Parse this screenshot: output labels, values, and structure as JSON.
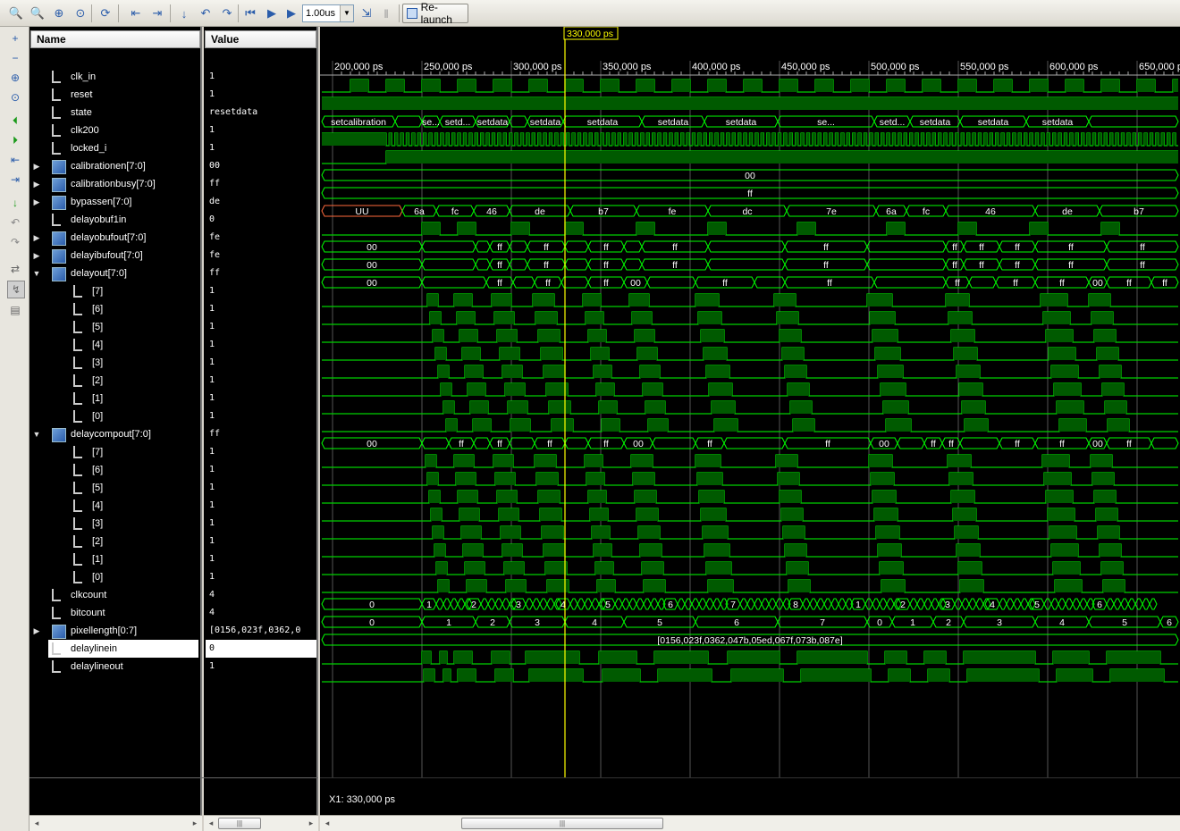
{
  "toolbar": {
    "time_value": "1.00us",
    "relaunch_label": "Re-launch"
  },
  "columns": {
    "name": "Name",
    "value": "Value"
  },
  "cursor": {
    "label": "330,000 ps",
    "readout": "X1: 330,000 ps"
  },
  "time_axis": {
    "ticks": [
      "200,000 ps",
      "250,000 ps",
      "300,000 ps",
      "350,000 ps",
      "400,000 ps",
      "450,000 ps",
      "500,000 ps",
      "550,000 ps",
      "600,000 ps",
      "650,000 ps"
    ]
  },
  "signals": [
    {
      "name": "clk_in",
      "value": "1",
      "level": 0,
      "kind": "bit",
      "expand": ""
    },
    {
      "name": "reset",
      "value": "1",
      "level": 0,
      "kind": "bit",
      "expand": ""
    },
    {
      "name": "state",
      "value": "resetdata",
      "level": 0,
      "kind": "bit",
      "expand": ""
    },
    {
      "name": "clk200",
      "value": "1",
      "level": 0,
      "kind": "bit",
      "expand": ""
    },
    {
      "name": "locked_i",
      "value": "1",
      "level": 0,
      "kind": "bit",
      "expand": ""
    },
    {
      "name": "calibrationen[7:0]",
      "value": "00",
      "level": 0,
      "kind": "bus",
      "expand": "▶"
    },
    {
      "name": "calibrationbusy[7:0]",
      "value": "ff",
      "level": 0,
      "kind": "bus",
      "expand": "▶"
    },
    {
      "name": "bypassen[7:0]",
      "value": "de",
      "level": 0,
      "kind": "bus",
      "expand": "▶"
    },
    {
      "name": "delayobuf1in",
      "value": "0",
      "level": 0,
      "kind": "bit",
      "expand": ""
    },
    {
      "name": "delayobufout[7:0]",
      "value": "fe",
      "level": 0,
      "kind": "bus",
      "expand": "▶"
    },
    {
      "name": "delayibufout[7:0]",
      "value": "fe",
      "level": 0,
      "kind": "bus",
      "expand": "▶"
    },
    {
      "name": "delayout[7:0]",
      "value": "ff",
      "level": 0,
      "kind": "bus",
      "expand": "▼"
    },
    {
      "name": "[7]",
      "value": "1",
      "level": 1,
      "kind": "bit",
      "expand": ""
    },
    {
      "name": "[6]",
      "value": "1",
      "level": 1,
      "kind": "bit",
      "expand": ""
    },
    {
      "name": "[5]",
      "value": "1",
      "level": 1,
      "kind": "bit",
      "expand": ""
    },
    {
      "name": "[4]",
      "value": "1",
      "level": 1,
      "kind": "bit",
      "expand": ""
    },
    {
      "name": "[3]",
      "value": "1",
      "level": 1,
      "kind": "bit",
      "expand": ""
    },
    {
      "name": "[2]",
      "value": "1",
      "level": 1,
      "kind": "bit",
      "expand": ""
    },
    {
      "name": "[1]",
      "value": "1",
      "level": 1,
      "kind": "bit",
      "expand": ""
    },
    {
      "name": "[0]",
      "value": "1",
      "level": 1,
      "kind": "bit",
      "expand": ""
    },
    {
      "name": "delaycompout[7:0]",
      "value": "ff",
      "level": 0,
      "kind": "bus",
      "expand": "▼"
    },
    {
      "name": "[7]",
      "value": "1",
      "level": 1,
      "kind": "bit",
      "expand": ""
    },
    {
      "name": "[6]",
      "value": "1",
      "level": 1,
      "kind": "bit",
      "expand": ""
    },
    {
      "name": "[5]",
      "value": "1",
      "level": 1,
      "kind": "bit",
      "expand": ""
    },
    {
      "name": "[4]",
      "value": "1",
      "level": 1,
      "kind": "bit",
      "expand": ""
    },
    {
      "name": "[3]",
      "value": "1",
      "level": 1,
      "kind": "bit",
      "expand": ""
    },
    {
      "name": "[2]",
      "value": "1",
      "level": 1,
      "kind": "bit",
      "expand": ""
    },
    {
      "name": "[1]",
      "value": "1",
      "level": 1,
      "kind": "bit",
      "expand": ""
    },
    {
      "name": "[0]",
      "value": "1",
      "level": 1,
      "kind": "bit",
      "expand": ""
    },
    {
      "name": "clkcount",
      "value": "4",
      "level": 0,
      "kind": "bit",
      "expand": ""
    },
    {
      "name": "bitcount",
      "value": "4",
      "level": 0,
      "kind": "bit",
      "expand": ""
    },
    {
      "name": "pixellength[0:7]",
      "value": "[0156,023f,0362,0",
      "level": 0,
      "kind": "bus",
      "expand": "▶"
    },
    {
      "name": "delaylinein",
      "value": "0",
      "level": 0,
      "kind": "bit",
      "expand": "",
      "selected": true
    },
    {
      "name": "delaylineout",
      "value": "1",
      "level": 0,
      "kind": "bit",
      "expand": ""
    }
  ],
  "bus_labels": {
    "state": [
      "setcalibration",
      "se...",
      "setd...",
      "setdata",
      "setdata",
      "setdata",
      "setdata",
      "setdata",
      "se...",
      "setd...",
      "setdata",
      "setdata",
      "setdata"
    ],
    "calibrationen": [
      "00"
    ],
    "calibrationbusy": [
      "ff"
    ],
    "bypassen": [
      "UU",
      "6a",
      "fc",
      "46",
      "de",
      "b7",
      "fe",
      "dc",
      "7e",
      "6a",
      "fc",
      "46",
      "de",
      "b7",
      "fe"
    ],
    "delayobufout": [
      "00",
      "ff",
      "ff",
      "ff",
      "ff",
      "ff",
      "ff",
      "ff",
      "ff",
      "ff",
      "ff"
    ],
    "delayibufout": [
      "00",
      "ff",
      "ff",
      "ff",
      "ff",
      "ff",
      "ff",
      "ff",
      "ff",
      "ff",
      "ff"
    ],
    "delayout": [
      "00",
      "ff",
      "ff",
      "ff",
      "00",
      "ff",
      "ff",
      "ff",
      "ff",
      "ff",
      "ff",
      "00",
      "ff"
    ],
    "delaycompout": [
      "00",
      "ff",
      "ff",
      "ff",
      "ff",
      "00",
      "ff",
      "00",
      "ff",
      "ff",
      "00",
      "ff",
      "ff",
      "ff",
      "ff",
      "00",
      "ff"
    ],
    "clkcount": [
      "0",
      "1",
      "2",
      "3",
      "4",
      "5",
      "6",
      "7",
      "8",
      "1",
      "2",
      "3",
      "4",
      "5",
      "6"
    ],
    "bitcount": [
      "0",
      "1",
      "2",
      "3",
      "4",
      "5",
      "6",
      "7",
      "0",
      "1",
      "2",
      "3",
      "4",
      "5",
      "6"
    ],
    "pixellength": [
      "[0156,023f,0362,047b,05ed,067f,073b,087e]"
    ]
  },
  "colors": {
    "wave": "#00d000",
    "bus": "#00ff00",
    "cursor": "#ffff00",
    "grid": "#555555",
    "undefined": "#ff6a3d"
  }
}
